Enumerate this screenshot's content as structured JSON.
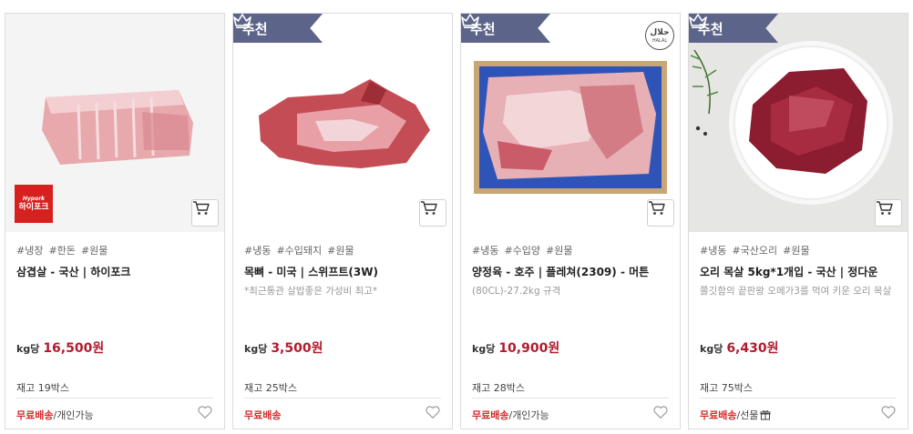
{
  "products": [
    {
      "tags": [
        "#냉장",
        "#한돈",
        "#원물"
      ],
      "name": "삼겹살 - 국산 | 하이포크",
      "subtitle": "",
      "price_unit": "kg당",
      "price": "16,500원",
      "stock": "재고 19박스",
      "shipping_free": "무료배송",
      "shipping_extra": "/개인가능",
      "brand_logo": {
        "line1": "Hypork",
        "line2": "하이포크"
      }
    },
    {
      "badge": "추천",
      "tags": [
        "#냉동",
        "#수입돼지",
        "#원물"
      ],
      "name": "목뼈 - 미국 | 스위프트(3W)",
      "subtitle": "*최근통관 살밥좋은 가성비 최고*",
      "price_unit": "kg당",
      "price": "3,500원",
      "stock": "재고 25박스",
      "shipping_free": "무료배송",
      "shipping_extra": ""
    },
    {
      "badge": "추천",
      "tags": [
        "#냉동",
        "#수입양",
        "#원물"
      ],
      "name": "양정육 - 호주 | 플레쳐(2309) - 머튼",
      "subtitle": "(80CL)-27.2kg 규격",
      "price_unit": "kg당",
      "price": "10,900원",
      "stock": "재고 28박스",
      "shipping_free": "무료배송",
      "shipping_extra": "/개인가능",
      "halal": {
        "line1": "حلال",
        "line2": "HALAL"
      }
    },
    {
      "badge": "추천",
      "tags": [
        "#냉동",
        "#국산오리",
        "#원물"
      ],
      "name": "오리 목살 5kg*1개입 - 국산 | 정다운",
      "subtitle": "쫄깃함의 끝판왕 오메가3를 먹여 키운 오리 목살",
      "price_unit": "kg당",
      "price": "6,430원",
      "stock": "재고 75박스",
      "shipping_free": "무료배송",
      "shipping_extra": "/선물"
    }
  ],
  "colors": {
    "badge_bg": "#5c6489",
    "price": "#b01c2e",
    "free_shipping": "#d42a2a"
  },
  "icons": [
    "crown-icon",
    "cart-icon",
    "heart-icon",
    "gift-icon"
  ]
}
